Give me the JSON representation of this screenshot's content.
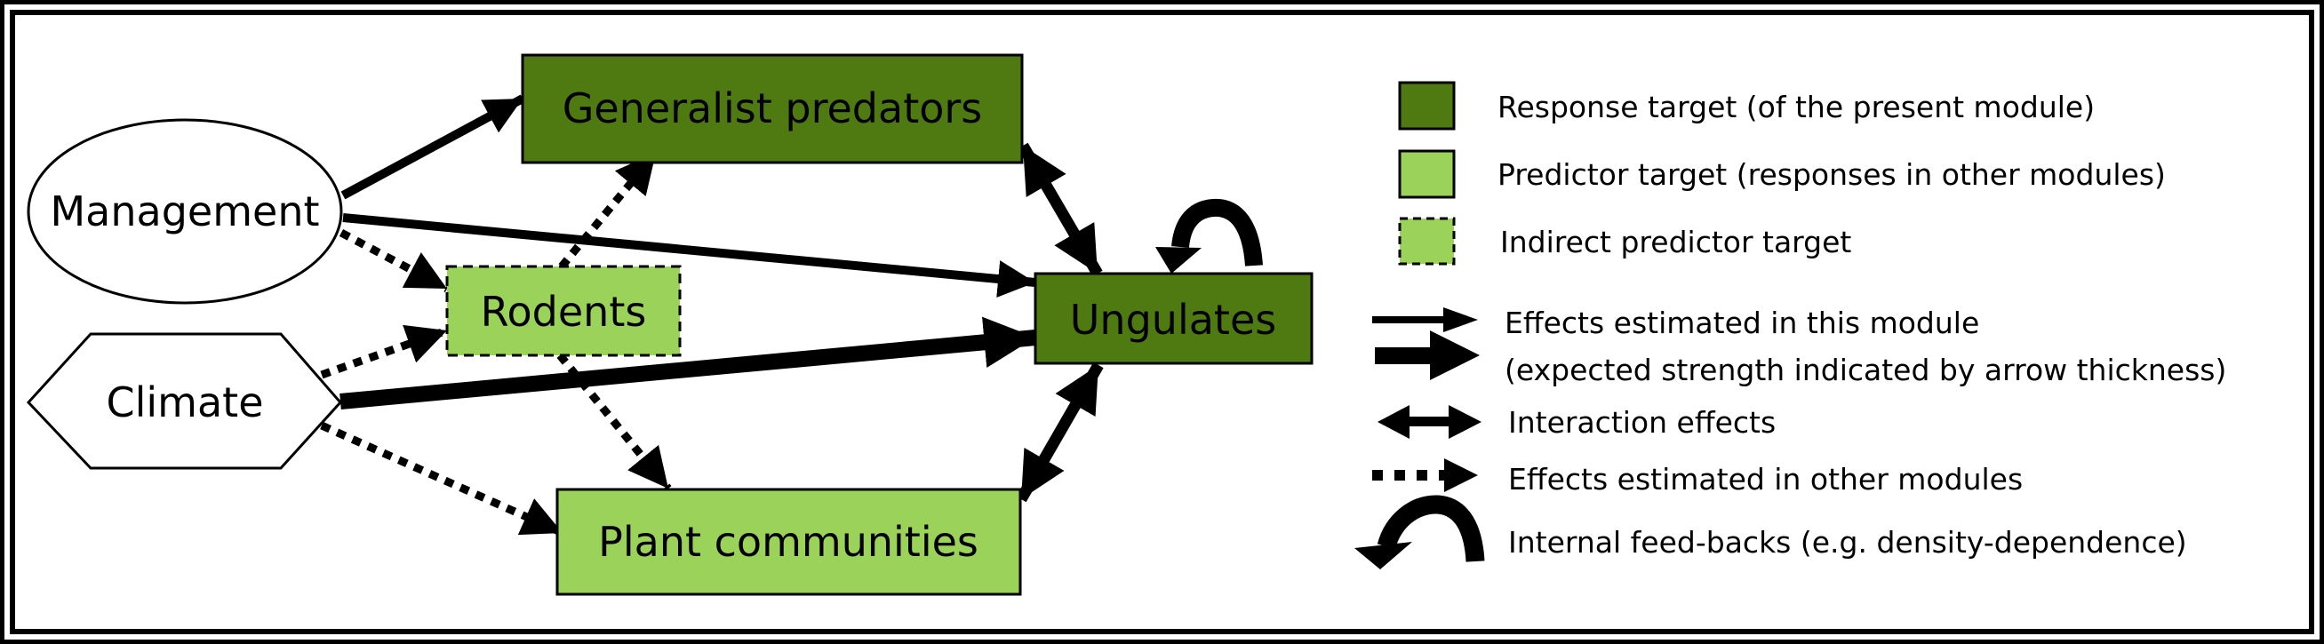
{
  "colors": {
    "response_target": "#4f7a12",
    "predictor_target": "#9bd25a",
    "stroke": "#000000",
    "background": "#ffffff"
  },
  "nodes": {
    "management": {
      "label": "Management",
      "shape": "ellipse",
      "kind": "driver"
    },
    "climate": {
      "label": "Climate",
      "shape": "hexagon",
      "kind": "driver"
    },
    "generalist_predators": {
      "label": "Generalist predators",
      "kind": "response-target"
    },
    "rodents": {
      "label": "Rodents",
      "kind": "indirect-predictor-target"
    },
    "ungulates": {
      "label": "Ungulates",
      "kind": "response-target"
    },
    "plant_communities": {
      "label": "Plant communities",
      "kind": "predictor-target"
    }
  },
  "edges": [
    {
      "from": "management",
      "to": "generalist_predators",
      "type": "effect-this-module",
      "strength": "medium"
    },
    {
      "from": "management",
      "to": "ungulates",
      "type": "effect-this-module",
      "strength": "medium"
    },
    {
      "from": "management",
      "to": "rodents",
      "type": "effect-other-modules"
    },
    {
      "from": "climate",
      "to": "rodents",
      "type": "effect-other-modules"
    },
    {
      "from": "climate",
      "to": "ungulates",
      "type": "effect-this-module",
      "strength": "strong"
    },
    {
      "from": "climate",
      "to": "plant_communities",
      "type": "effect-other-modules"
    },
    {
      "from": "rodents",
      "to": "generalist_predators",
      "type": "effect-other-modules"
    },
    {
      "from": "rodents",
      "to": "plant_communities",
      "type": "effect-other-modules"
    },
    {
      "from": "generalist_predators",
      "to": "ungulates",
      "type": "interaction"
    },
    {
      "from": "plant_communities",
      "to": "ungulates",
      "type": "interaction"
    },
    {
      "from": "ungulates",
      "to": "ungulates",
      "type": "internal-feedback"
    }
  ],
  "legend": {
    "response_target": "Response target (of the present module)",
    "predictor_target": "Predictor target (responses in other modules)",
    "indirect_predictor_target": "Indirect predictor target",
    "effects_this_module_line1": "Effects estimated in this module",
    "effects_this_module_line2": "(expected strength indicated by arrow thickness)",
    "interaction_effects": "Interaction effects",
    "effects_other_modules": "Effects estimated in other modules",
    "internal_feedbacks": "Internal feed-backs (e.g. density-dependence)"
  }
}
